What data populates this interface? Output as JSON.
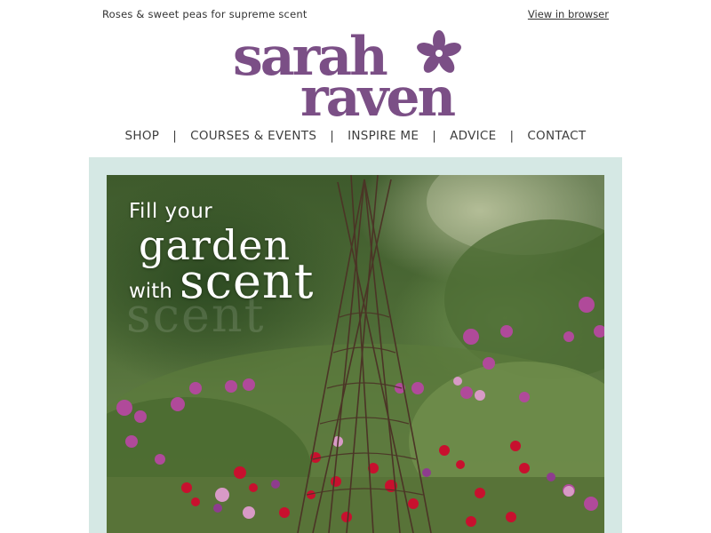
{
  "preheader": {
    "text": "Roses & sweet peas for supreme scent",
    "view_in_browser": "View in browser"
  },
  "logo": {
    "line1": "sarah",
    "line2": "raven",
    "brand_color": "#7b4f86"
  },
  "nav": {
    "items": [
      "SHOP",
      "COURSES & EVENTS",
      "INSPIRE ME",
      "ADVICE",
      "CONTACT"
    ],
    "separator": "|"
  },
  "hero": {
    "frame_color": "#d5e8e4",
    "line1": "Fill your",
    "line2": "garden",
    "line3": "with",
    "line4": "scent",
    "ghost_text": "scent"
  }
}
